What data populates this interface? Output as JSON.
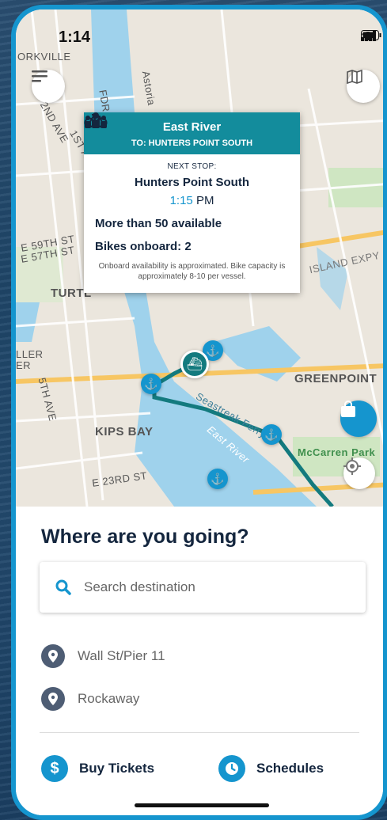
{
  "status_bar": {
    "time": "1:14"
  },
  "map": {
    "labels": [
      "ORKVILLE",
      "FDR",
      "Astoria",
      "2ND AVE",
      "1ST AVE",
      "E 59TH ST",
      "E 57TH ST",
      "TURTL",
      "LLER",
      "ER",
      "5TH AVE",
      "GREENPOINT",
      "KIPS BAY",
      "E 23RD ST",
      "Seastreak Ferry",
      "East River",
      "McCarren Park",
      "ISLAND EXPY"
    ],
    "icons": [
      "menu-icon",
      "map-icon",
      "shopping-bag-icon",
      "locate-icon",
      "anchor-icon",
      "ferry-icon"
    ]
  },
  "popup": {
    "title": "East River",
    "destination": "TO: HUNTERS POINT SOUTH",
    "next_label": "NEXT STOP:",
    "next_stop": "Hunters Point South",
    "time_value": "1:15",
    "time_suffix": "PM",
    "availability": "More than 50 available",
    "bikes": "Bikes onboard: 2",
    "note": "Onboard availability is approximated. Bike capacity is approximately 8-10 per vessel."
  },
  "sheet": {
    "title": "Where are you going?",
    "search_placeholder": "Search destination",
    "recents": [
      "Wall St/Pier 11",
      "Rockaway"
    ],
    "buy_label": "Buy Tickets",
    "buy_symbol": "$",
    "schedules_label": "Schedules"
  },
  "colors": {
    "accent": "#1595ce",
    "header": "#138c9c",
    "navy": "#14263e",
    "water": "#9fd2ec"
  }
}
